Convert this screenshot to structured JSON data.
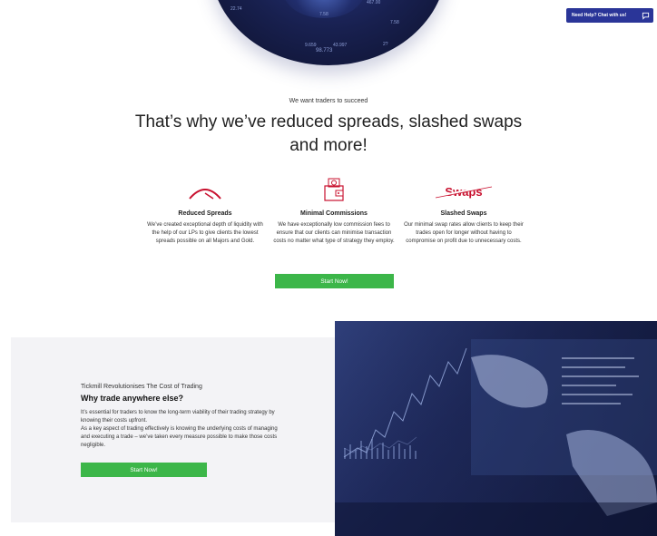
{
  "hero": {
    "numbers": [
      "22.74",
      "7.58",
      "467.00",
      "7.58",
      "9.659",
      "43.997",
      "98.773",
      "2?"
    ]
  },
  "chat": {
    "label": "Need Help? Chat with us!",
    "icon": "chat-bubble-icon"
  },
  "intro": {
    "eyebrow": "We want traders to succeed",
    "headline": "That’s why we’ve reduced spreads, slashed swaps and more!"
  },
  "features": [
    {
      "icon": "gauge-icon",
      "title": "Reduced Spreads",
      "description": "We’ve created exceptional depth of liquidity with the help of our LPs to give clients the lowest spreads possible on all Majors and Gold."
    },
    {
      "icon": "wallet-icon",
      "title": "Minimal Commissions",
      "description": "We have exceptionally low commission fees to ensure that our clients can minimise transaction costs no matter what type of strategy they employ."
    },
    {
      "icon": "swaps-icon",
      "icon_text": "Swaps",
      "title": "Slashed Swaps",
      "description": "Our minimal swap rates allow clients to keep their trades open for longer without having to compromise on profit due to unnecessary costs."
    }
  ],
  "cta": {
    "label": "Start Now!"
  },
  "panel": {
    "eyebrow": "Tickmill Revolutionises The Cost of Trading",
    "title": "Why trade anywhere else?",
    "paragraph1": "It’s essential for traders to know the long-term viability of their trading strategy by knowing their costs upfront.",
    "paragraph2": "As a key aspect of trading effectively is knowing the underlying costs of managing and executing a trade – we’ve taken every measure possible to make those costs negligible.",
    "button_label": "Start Now!"
  },
  "colors": {
    "accent_green": "#3cb649",
    "chat_blue": "#2a3598",
    "icon_red": "#c8102e"
  }
}
